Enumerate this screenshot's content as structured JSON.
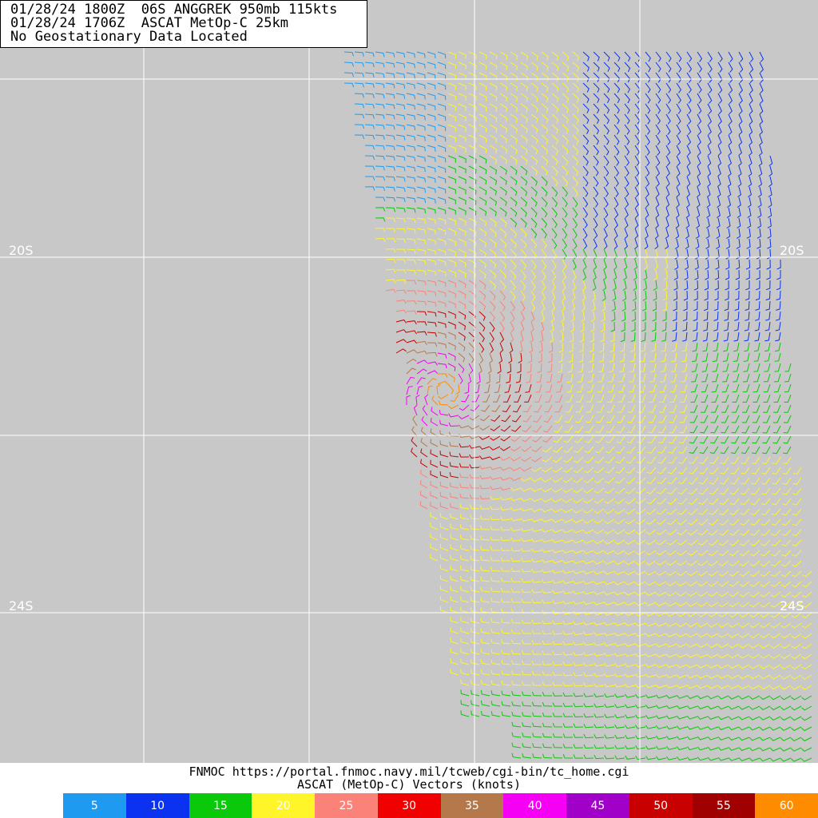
{
  "header": {
    "line1": "01/28/24 1800Z  06S ANGGREK 950mb 115kts",
    "line2": "01/28/24 1706Z  ASCAT MetOp-C 25km",
    "line3": "No Geostationary Data Located"
  },
  "map": {
    "background": "#c8c8c8",
    "grid_color": "#ffffff",
    "lat_labels": [
      "20S",
      "20S",
      "24S",
      "24S"
    ]
  },
  "footer": {
    "source": "FNMOC https://portal.fnmoc.navy.mil/tcweb/cgi-bin/tc_home.cgi",
    "subtitle": "ASCAT (MetOp-C) Vectors (knots)"
  },
  "legend": [
    {
      "label": "5",
      "color": "#1e9bf0"
    },
    {
      "label": "10",
      "color": "#0a32f0"
    },
    {
      "label": "15",
      "color": "#0ac80a"
    },
    {
      "label": "20",
      "color": "#fff528"
    },
    {
      "label": "25",
      "color": "#fa8278"
    },
    {
      "label": "30",
      "color": "#f00000"
    },
    {
      "label": "35",
      "color": "#b4784b"
    },
    {
      "label": "40",
      "color": "#f500f5"
    },
    {
      "label": "45",
      "color": "#a000c8"
    },
    {
      "label": "50",
      "color": "#c80000"
    },
    {
      "label": "55",
      "color": "#a00000"
    },
    {
      "label": "60",
      "color": "#ff8c00"
    }
  ]
}
